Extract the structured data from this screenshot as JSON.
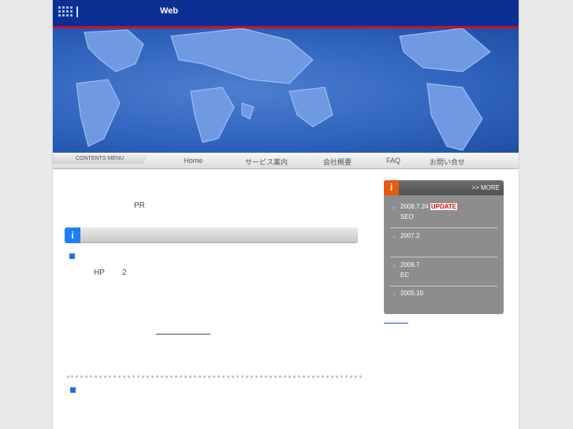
{
  "header": {
    "title": "Web"
  },
  "nav": {
    "contents_menu": "CONTENTS MENU",
    "items": [
      "Home",
      "サービス案内",
      "会社概要",
      "FAQ",
      "お問い合せ"
    ]
  },
  "main": {
    "pr_text": "PR",
    "section_icon": "i",
    "hp_text": "HP",
    "hp_num": "2"
  },
  "news": {
    "icon": "i",
    "more": ">> MORE",
    "items": [
      {
        "date": "2008.7.24",
        "badge": "UPDATE",
        "title": "SEO"
      },
      {
        "date": "2007.2",
        "title": ""
      },
      {
        "date": "2006.7",
        "title": "EC"
      },
      {
        "date": "2005.10",
        "title": ""
      }
    ]
  },
  "colors": {
    "header": "#0b2f93",
    "accent": "#c8102e",
    "bullet": "#1d6fe8",
    "news_icon": "#e8590c"
  }
}
